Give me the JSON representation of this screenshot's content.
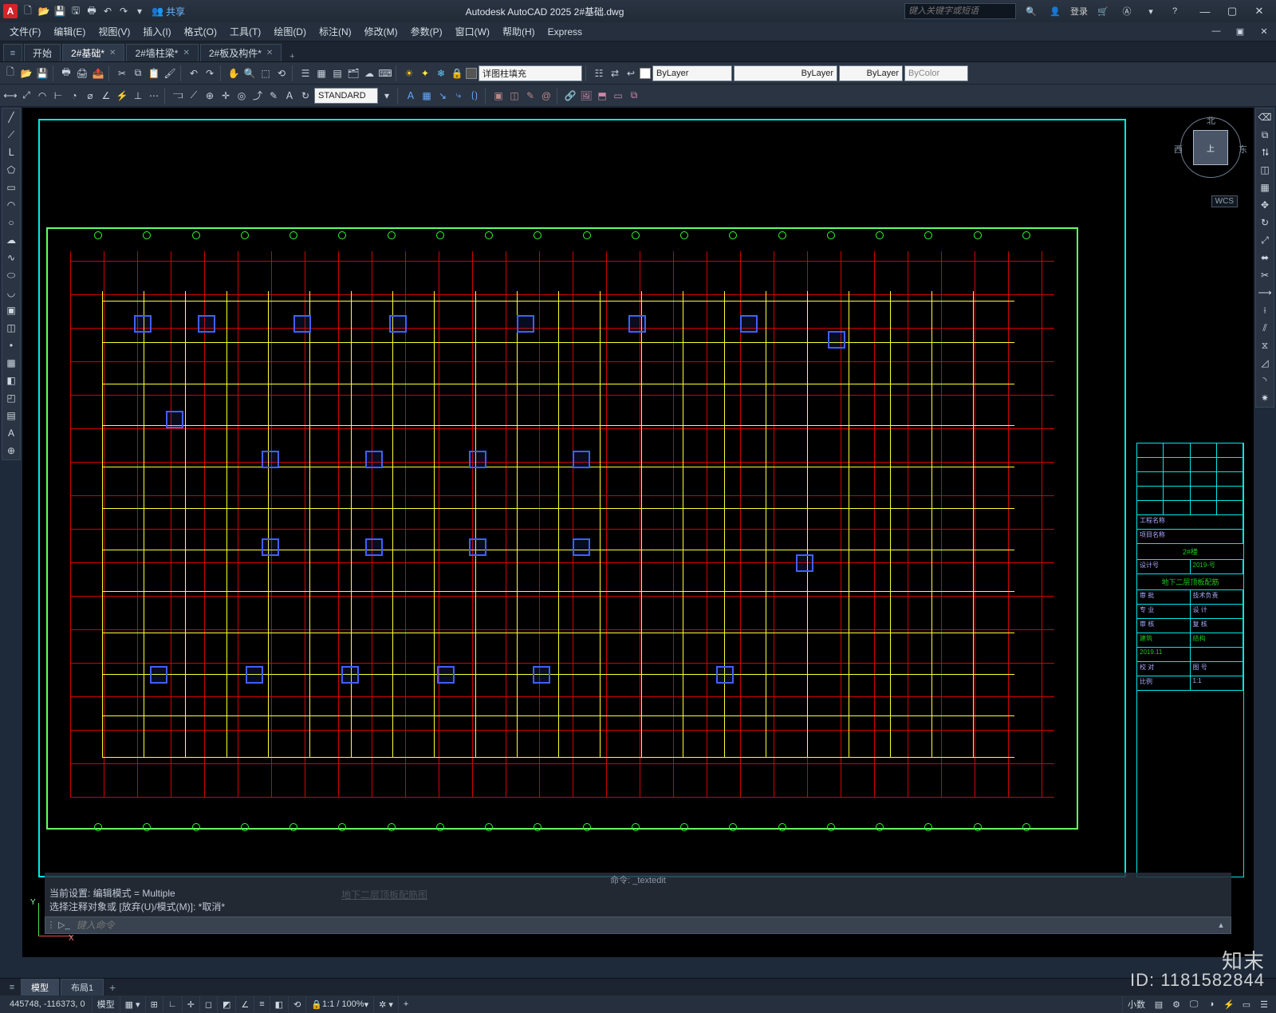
{
  "titlebar": {
    "app_logo": "A",
    "share_label": "共享",
    "app_title": "Autodesk AutoCAD 2025   2#基础.dwg",
    "search_placeholder": "键入关键字或短语",
    "login_label": "登录"
  },
  "menus": [
    {
      "label": "文件(F)"
    },
    {
      "label": "编辑(E)"
    },
    {
      "label": "视图(V)"
    },
    {
      "label": "插入(I)"
    },
    {
      "label": "格式(O)"
    },
    {
      "label": "工具(T)"
    },
    {
      "label": "绘图(D)"
    },
    {
      "label": "标注(N)"
    },
    {
      "label": "修改(M)"
    },
    {
      "label": "参数(P)"
    },
    {
      "label": "窗口(W)"
    },
    {
      "label": "帮助(H)"
    },
    {
      "label": "Express"
    }
  ],
  "filetabs": {
    "start": "开始",
    "tabs": [
      {
        "label": "2#基础*",
        "active": true
      },
      {
        "label": "2#墙柱梁*",
        "active": false
      },
      {
        "label": "2#板及构件*",
        "active": false
      }
    ]
  },
  "toolbar2": {
    "hatch_label": "详图柱填充",
    "layer_value": "ByLayer",
    "linetype_value": "ByLayer",
    "lineweight_value": "ByLayer",
    "color_value": "ByColor"
  },
  "toolbar3": {
    "textstyle_value": "STANDARD"
  },
  "viewcube": {
    "top": "上",
    "north": "北",
    "west": "西",
    "east": "东",
    "wcs": "WCS"
  },
  "drawing": {
    "title": "地下二层顶板配筋图",
    "titleblock": {
      "proj1": "工程名称",
      "proj2": "项目名称",
      "bldg": "2#楼",
      "phase_label": "设计号",
      "phase": "2019-号",
      "sheet_name": "地下二层顶板配筋",
      "roles": {
        "shenpi": "审 批",
        "sheji": "技术负责",
        "zhuanye": "专 业",
        "shehe": "设 计",
        "jianding": "审 核",
        "fuhe": "复 核",
        "xiaodui": "校 对",
        "tuhao": "图 号"
      },
      "jianzhu": "建筑",
      "jiegou": "结构",
      "date": "2019.11",
      "scale_lbl": "比例",
      "scale": "1:1"
    }
  },
  "command": {
    "hint": "_textedit",
    "prefix": "命令:",
    "line1": "当前设置: 编辑模式 = Multiple",
    "line2": "选择注释对象或 [放弃(U)/模式(M)]: *取消*",
    "placeholder": "键入命令"
  },
  "layout_tabs": {
    "model": "模型",
    "layout1": "布局1"
  },
  "statusbar": {
    "coords": "445748, -116373, 0",
    "model": "模型",
    "scale": "1:1 / 100%",
    "decimal": "小数"
  },
  "watermark": {
    "brand": "知末",
    "id": "ID: 1181582844"
  }
}
